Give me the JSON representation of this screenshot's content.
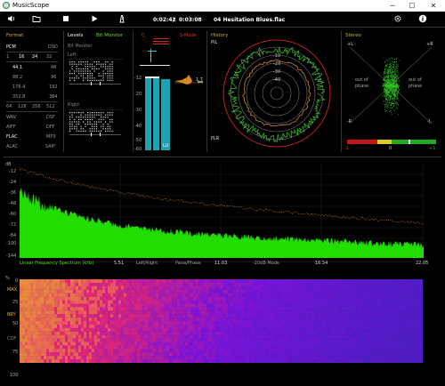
{
  "window": {
    "title": "MusicScope",
    "minimize": "─",
    "maximize": "☐",
    "close": "✕"
  },
  "toolbar": {
    "time_elapsed": "0:02:42",
    "time_separator": "/",
    "time_total": "0:03:08",
    "track": "04 Hesitation Blues.flac"
  },
  "format": {
    "title": "Format",
    "pcm": "PCM",
    "dsd": "DSD",
    "bits": [
      "1",
      "16",
      "24",
      "32"
    ],
    "bits_active": [
      "16",
      "24"
    ],
    "rates_left": [
      "44.1",
      "88.2",
      "176.4",
      "352.8"
    ],
    "rates_right": [
      "48",
      "96",
      "192",
      "384"
    ],
    "active_rate": "44.1",
    "dsd_rates": [
      "64",
      "128",
      "256",
      "512"
    ],
    "containers_left": [
      "WAV",
      "AIFF",
      "FLAC",
      "ALAC"
    ],
    "containers_right": [
      "DSF",
      "DFF",
      "MP3",
      "SAIF"
    ],
    "active_container": "FLAC"
  },
  "levels": {
    "title": "Levels",
    "bit_monitor_tab": "Bit Monitor",
    "bit_monitor_label": "Bit Monitor",
    "left": "Left",
    "right": "Right",
    "a_label": "-24"
  },
  "meter": {
    "top_label": "0",
    "scale": [
      "-12",
      "-20",
      "-30",
      "-40",
      "-50",
      "-60"
    ],
    "peak_left": "-5",
    "lu_label": "LU",
    "s_mode": "S-Mode",
    "value": "1.7"
  },
  "history": {
    "title": "History",
    "pll": "PIL",
    "plr": "PLR",
    "rings": [
      "-10",
      "-20",
      "-30",
      "-40"
    ]
  },
  "stereo": {
    "title": "Stereo",
    "plus_l": "+L",
    "plus_r": "+R",
    "minus_l": "-R",
    "minus_r": "-L",
    "out_of_phase_left": "out of phase",
    "out_of_phase_right": "out of phase",
    "corr_minus": "-1",
    "corr_zero": "0",
    "corr_plus": "+1"
  },
  "spectrum": {
    "db_label": "dB",
    "y_ticks": [
      "-12",
      "-24",
      "-36",
      "-48",
      "-60",
      "-72",
      "-84",
      "-100",
      "-144"
    ],
    "footer_title": "Linear Frequency Spectrum (kHz)",
    "x_ticks": [
      "5.51",
      "11.03",
      "16.54",
      "22.05"
    ],
    "modes": [
      "Left/Right",
      "Pana/Phase",
      "-20dB Mode"
    ]
  },
  "spectrogram": {
    "pct_label": "%",
    "y_ticks": [
      "0",
      "25",
      "50",
      "75",
      "100"
    ],
    "side_labels": [
      "MAX",
      "BRY",
      "COF"
    ]
  },
  "colors": {
    "accent_green": "#6ddc2b",
    "accent_yellow": "#c9b23a",
    "meter_teal": "#1aa3b0",
    "meter_red": "#d02020",
    "spectrum_green": "#22dd00",
    "peak_orange": "#d88a22"
  }
}
